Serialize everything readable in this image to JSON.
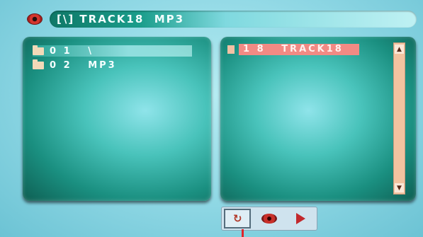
{
  "title_bar": {
    "text": "[\\] TRACK18  MP3"
  },
  "folder_list": {
    "items": [
      {
        "label": "0 1   \\",
        "selected": true
      },
      {
        "label": "0 2   MP3",
        "selected": false
      }
    ]
  },
  "file_list": {
    "items": [
      {
        "label": "1 8   TRACK18",
        "highlighted": true
      }
    ]
  },
  "scrollbar": {
    "up_glyph": "▲",
    "down_glyph": "▼"
  },
  "toolbar": {
    "buttons": [
      {
        "icon": "repeat-icon",
        "glyph": "↻",
        "active": true
      },
      {
        "icon": "disc-icon",
        "active": false
      },
      {
        "icon": "play-icon",
        "active": false
      }
    ]
  },
  "colors": {
    "background": "#9edde7",
    "panel": "#1a8f80",
    "highlight": "#f28a84",
    "scrollbar": "#f2c3a0"
  }
}
